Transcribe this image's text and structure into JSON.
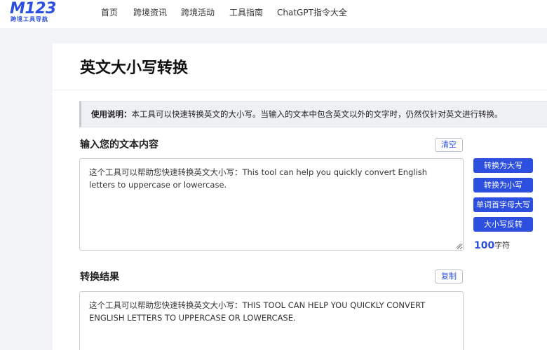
{
  "brand": {
    "logo_main": "M123",
    "logo_sub": "跨境工具导航",
    "accent_color": "#2c4fe0"
  },
  "nav": {
    "items": [
      {
        "label": "首页"
      },
      {
        "label": "跨境资讯"
      },
      {
        "label": "跨境活动"
      },
      {
        "label": "工具指南"
      },
      {
        "label": "ChatGPT指令大全"
      }
    ]
  },
  "page": {
    "title": "英文大小写转换",
    "notice_label": "使用说明：",
    "notice_text": "本工具可以快速转换英文的大小写。当输入的文本中包含英文以外的文字时，仍然仅针对英文进行转换。"
  },
  "input_section": {
    "title": "输入您的文本内容",
    "clear_label": "清空",
    "value": "这个工具可以帮助您快速转换英文大小写：This tool can help you quickly convert English letters to uppercase or lowercase."
  },
  "actions": {
    "upper_label": "转换为大写",
    "lower_label": "转换为小写",
    "capitalize_label": "单词首字母大写",
    "swap_label": "大小写反转"
  },
  "counter": {
    "value": "100",
    "unit": "字符"
  },
  "output_section": {
    "title": "转换结果",
    "copy_label": "复制",
    "value": "这个工具可以帮助您快速转换英文大小写：THIS TOOL CAN HELP YOU QUICKLY CONVERT ENGLISH LETTERS TO UPPERCASE OR LOWERCASE."
  }
}
